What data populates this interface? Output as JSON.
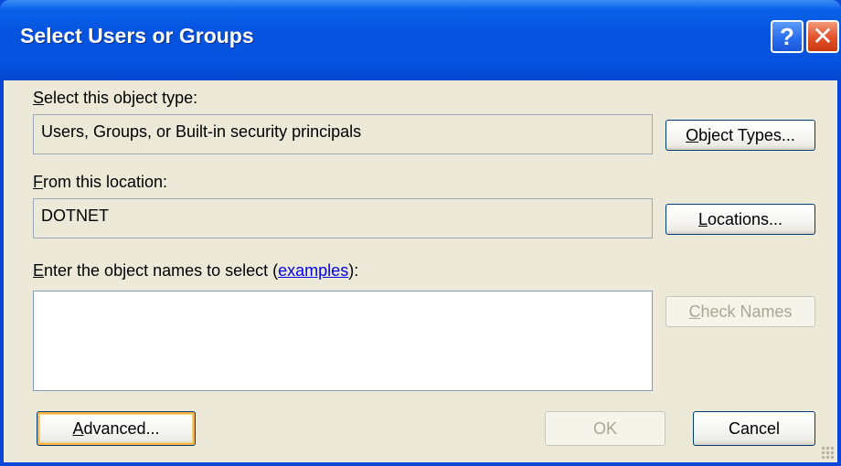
{
  "dialog": {
    "title": "Select Users or Groups"
  },
  "object_type": {
    "label_accel": "S",
    "label_rest": "elect this object type:",
    "value": "Users, Groups, or Built-in security principals",
    "button_accel": "O",
    "button_rest": "bject Types..."
  },
  "location": {
    "label_accel": "F",
    "label_rest": "rom this location:",
    "value": "DOTNET",
    "button_accel": "L",
    "button_rest": "ocations..."
  },
  "names": {
    "label_accel": "E",
    "label_rest": "nter the object names to select (",
    "examples_link": "examples",
    "label_tail": "):",
    "value": "",
    "check_accel": "C",
    "check_rest": "heck Names"
  },
  "footer": {
    "advanced_accel": "A",
    "advanced_rest": "dvanced...",
    "ok_label": "OK",
    "cancel_label": "Cancel"
  },
  "icons": {
    "help": "?",
    "close": "✕"
  }
}
